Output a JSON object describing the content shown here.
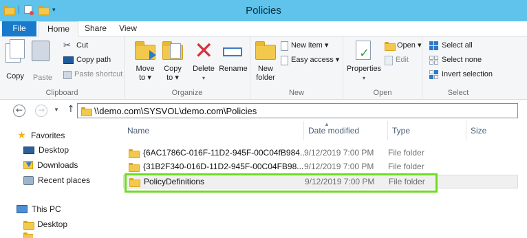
{
  "window": {
    "title": "Policies"
  },
  "ribbon_tabs": {
    "file": "File",
    "home": "Home",
    "share": "Share",
    "view": "View"
  },
  "clipboard": {
    "copy": "Copy",
    "paste": "Paste",
    "cut": "Cut",
    "copy_path": "Copy path",
    "paste_shortcut": "Paste shortcut",
    "label": "Clipboard"
  },
  "organize": {
    "move_to": "Move",
    "move_to_2": "to ▾",
    "copy_to": "Copy",
    "copy_to_2": "to ▾",
    "delete": "Delete",
    "delete_caret": "▾",
    "rename": "Rename",
    "label": "Organize"
  },
  "new": {
    "new_folder": "New",
    "new_folder_2": "folder",
    "new_item": "New item ▾",
    "easy_access": "Easy access ▾",
    "label": "New"
  },
  "open": {
    "properties": "Properties",
    "properties_caret": "▾",
    "open": "Open ▾",
    "edit": "Edit",
    "label": "Open"
  },
  "select": {
    "select_all": "Select all",
    "select_none": "Select none",
    "invert": "Invert selection",
    "label": "Select"
  },
  "address": {
    "path": "\\\\demo.com\\SYSVOL\\demo.com\\Policies"
  },
  "nav_pane": {
    "favorites": "Favorites",
    "desktop": "Desktop",
    "downloads": "Downloads",
    "recent": "Recent places",
    "this_pc": "This PC",
    "pc_desktop": "Desktop"
  },
  "columns": {
    "name": "Name",
    "date": "Date modified",
    "type": "Type",
    "size": "Size"
  },
  "files": [
    {
      "name": "{6AC1786C-016F-11D2-945F-00C04fB984...",
      "date": "9/12/2019 7:00 PM",
      "type": "File folder"
    },
    {
      "name": "{31B2F340-016D-11D2-945F-00C04FB98...",
      "date": "9/12/2019 7:00 PM",
      "type": "File folder"
    },
    {
      "name": "PolicyDefinitions",
      "date": "9/12/2019 7:00 PM",
      "type": "File folder"
    }
  ]
}
